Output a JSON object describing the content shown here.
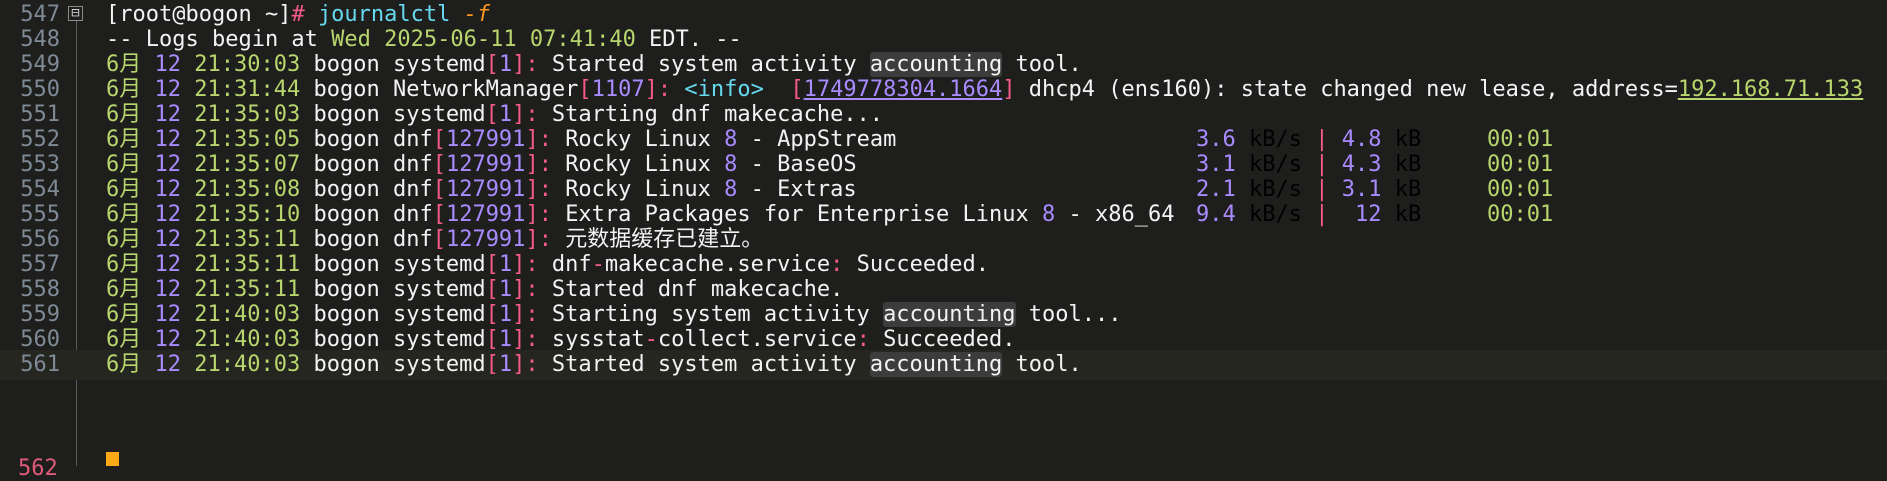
{
  "terminal": {
    "line_numbers": [
      "547",
      "548",
      "549",
      "550",
      "551",
      "552",
      "553",
      "554",
      "555",
      "556",
      "557",
      "558",
      "559",
      "560",
      "561",
      "562"
    ],
    "fold_icon": "⊟",
    "prompt": {
      "user_host": "[root@bogon ~]",
      "hash": "#",
      "command": "journalctl",
      "flag": "-f"
    },
    "begin": {
      "prefix": "-- Logs begin at ",
      "date": "Wed 2025-06-11 07:41:40",
      "suffix": " EDT. --"
    },
    "entries": [
      {
        "month": "6月",
        "day": "12",
        "time": "21:30:03",
        "host": "bogon",
        "proc": "systemd",
        "pid": "1",
        "text_pre": "Started system activity ",
        "hl": "accounting",
        "text_post": " tool."
      },
      {
        "month": "6月",
        "day": "12",
        "time": "21:31:44",
        "host": "bogon",
        "proc": "NetworkManager",
        "pid": "1107",
        "info": "<info>",
        "ts": "1749778304.1664",
        "msg1": "dhcp4 (ens160)",
        "msg2": ": state changed new lease, address=",
        "addr": "192.168.71.133"
      },
      {
        "month": "6月",
        "day": "12",
        "time": "21:35:03",
        "host": "bogon",
        "proc": "systemd",
        "pid": "1",
        "text_pre": "Starting dnf makecache...",
        "hl": "",
        "text_post": ""
      },
      {
        "month": "6月",
        "day": "12",
        "time": "21:35:05",
        "host": "bogon",
        "proc": "dnf",
        "pid": "127991",
        "repo_a": "Rocky Linux ",
        "repo_n": "8",
        "repo_b": " - AppStream",
        "speed": "3.6",
        "speed_u": " kB/s ",
        "bar": "|",
        "size": "4.8",
        "size_u": " kB",
        "elapsed": "00:01"
      },
      {
        "month": "6月",
        "day": "12",
        "time": "21:35:07",
        "host": "bogon",
        "proc": "dnf",
        "pid": "127991",
        "repo_a": "Rocky Linux ",
        "repo_n": "8",
        "repo_b": " - BaseOS",
        "speed": "3.1",
        "speed_u": " kB/s ",
        "bar": "|",
        "size": "4.3",
        "size_u": " kB",
        "elapsed": "00:01"
      },
      {
        "month": "6月",
        "day": "12",
        "time": "21:35:08",
        "host": "bogon",
        "proc": "dnf",
        "pid": "127991",
        "repo_a": "Rocky Linux ",
        "repo_n": "8",
        "repo_b": " - Extras",
        "speed": "2.1",
        "speed_u": " kB/s ",
        "bar": "|",
        "size": "3.1",
        "size_u": " kB",
        "elapsed": "00:01"
      },
      {
        "month": "6月",
        "day": "12",
        "time": "21:35:10",
        "host": "bogon",
        "proc": "dnf",
        "pid": "127991",
        "repo_a": "Extra Packages for Enterprise Linux ",
        "repo_n": "8",
        "repo_b": " - x86_64",
        "speed": "9.4",
        "speed_u": " kB/s ",
        "bar": "|",
        "size": "12",
        "size_u": " kB",
        "elapsed": "00:01"
      },
      {
        "month": "6月",
        "day": "12",
        "time": "21:35:11",
        "host": "bogon",
        "proc": "dnf",
        "pid": "127991",
        "text_pre": "元数据缓存已建立。",
        "hl": "",
        "text_post": ""
      },
      {
        "month": "6月",
        "day": "12",
        "time": "21:35:11",
        "host": "bogon",
        "proc": "systemd",
        "pid": "1",
        "svc_a": "dnf",
        "svc_dash": "-",
        "svc_b": "makecache.service",
        "svc_rest": "Succeeded."
      },
      {
        "month": "6月",
        "day": "12",
        "time": "21:35:11",
        "host": "bogon",
        "proc": "systemd",
        "pid": "1",
        "text_pre": "Started dnf makecache.",
        "hl": "",
        "text_post": ""
      },
      {
        "month": "6月",
        "day": "12",
        "time": "21:40:03",
        "host": "bogon",
        "proc": "systemd",
        "pid": "1",
        "text_pre": "Starting system activity ",
        "hl": "accounting",
        "text_post": " tool..."
      },
      {
        "month": "6月",
        "day": "12",
        "time": "21:40:03",
        "host": "bogon",
        "proc": "systemd",
        "pid": "1",
        "svc_a": "sysstat",
        "svc_dash": "-",
        "svc_b": "collect.service",
        "svc_rest": "Succeeded."
      },
      {
        "month": "6月",
        "day": "12",
        "time": "21:40:03",
        "host": "bogon",
        "proc": "systemd",
        "pid": "1",
        "text_pre": "Started system activity ",
        "hl": "accounting",
        "text_post": " tool."
      }
    ]
  }
}
